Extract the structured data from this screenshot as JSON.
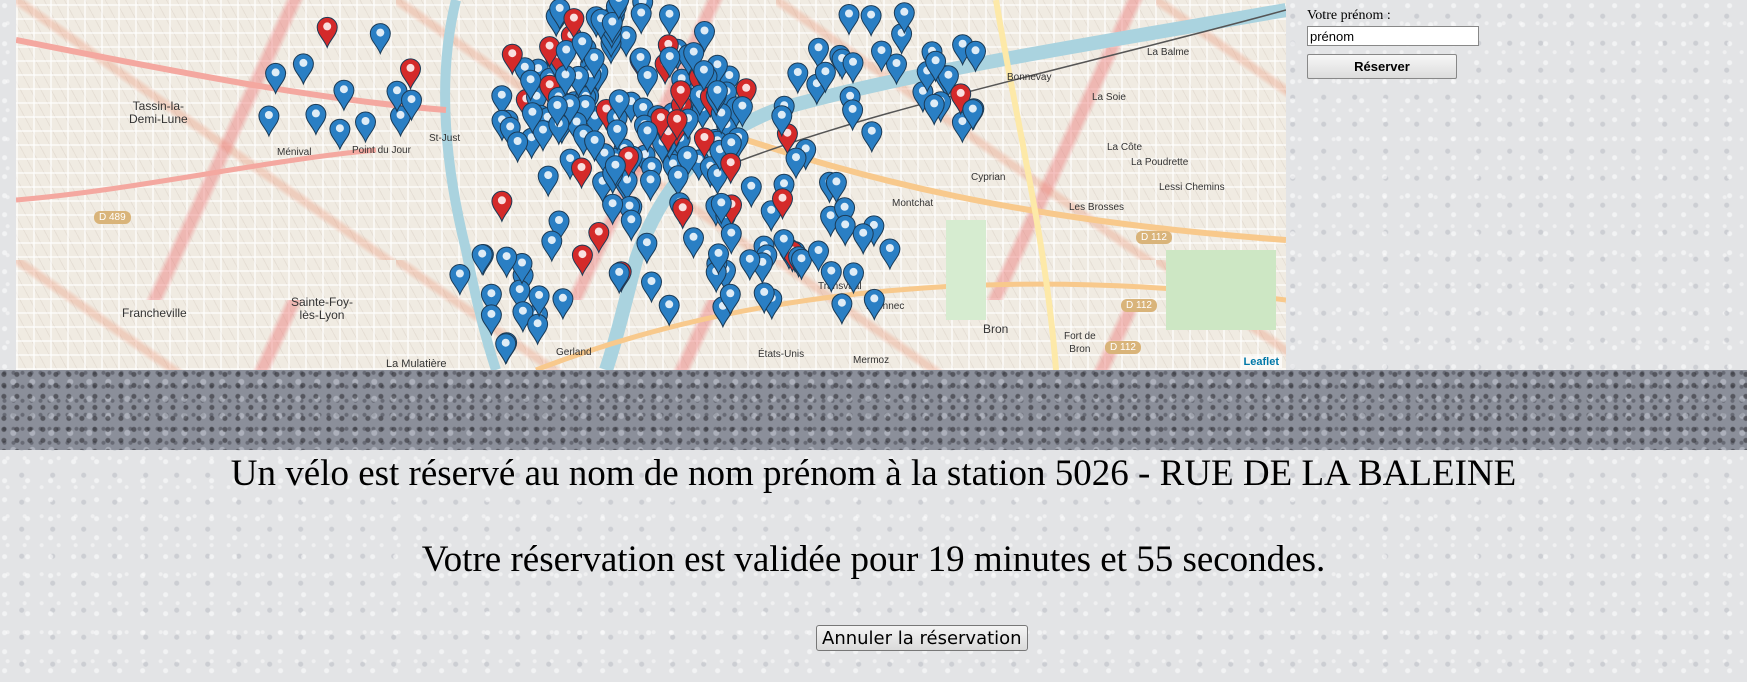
{
  "map": {
    "attribution": "Leaflet",
    "place_labels": [
      {
        "name": "tassin",
        "text": "Tassin-la-\nDemi-Lune"
      },
      {
        "name": "sainte-foy",
        "text": "Sainte-Foy-\nlès-Lyon"
      },
      {
        "name": "francheville",
        "text": "Francheville"
      },
      {
        "name": "point-du-jour",
        "text": "Point du Jour"
      },
      {
        "name": "montchat",
        "text": "Montchat"
      },
      {
        "name": "transvaal",
        "text": "Transvaal"
      },
      {
        "name": "bron",
        "text": "Bron"
      },
      {
        "name": "la-soie",
        "text": "La Soie"
      },
      {
        "name": "la-cote",
        "text": "La Côte"
      },
      {
        "name": "la-poudrette",
        "text": "La Poudrette"
      },
      {
        "name": "les-brosses",
        "text": "Les Brosses"
      },
      {
        "name": "cyprian",
        "text": "Cyprian"
      },
      {
        "name": "laennec",
        "text": "Laennec"
      },
      {
        "name": "la-mulatiere",
        "text": "La Mulatière"
      },
      {
        "name": "fort-de-bron",
        "text": "Fort de\nBron"
      },
      {
        "name": "la-balme",
        "text": "La Balme"
      },
      {
        "name": "bonnevay",
        "text": "Bonnevay"
      },
      {
        "name": "st-just",
        "text": "St-Just"
      },
      {
        "name": "menival",
        "text": "Ménival"
      },
      {
        "name": "gerland",
        "text": "Gerland"
      },
      {
        "name": "etats-unis",
        "text": "États-Unis"
      },
      {
        "name": "mermoz",
        "text": "Mermoz"
      },
      {
        "name": "lessi-chemins",
        "text": "Lessi Chemins"
      }
    ],
    "road_badges": [
      "D 489",
      "D 112",
      "D 112",
      "D 112"
    ],
    "colors": {
      "blue_marker": "#2a7fc4",
      "red_marker": "#d42a2a"
    }
  },
  "form": {
    "firstname_label": "Votre prénom :",
    "firstname_value": "prénom",
    "reserve_label": "Réserver"
  },
  "status": {
    "reservation_text": "Un vélo est réservé au nom de nom prénom à la station 5026 - RUE DE LA BALEINE",
    "validity_text": "Votre réservation est validée pour 19 minutes et 55 secondes.",
    "cancel_label": "Annuler la réservation"
  }
}
